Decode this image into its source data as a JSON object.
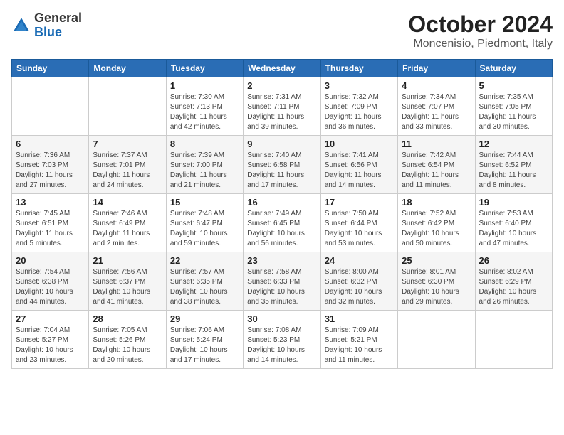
{
  "logo": {
    "general": "General",
    "blue": "Blue"
  },
  "title": {
    "month_year": "October 2024",
    "location": "Moncenisio, Piedmont, Italy"
  },
  "headers": [
    "Sunday",
    "Monday",
    "Tuesday",
    "Wednesday",
    "Thursday",
    "Friday",
    "Saturday"
  ],
  "weeks": [
    [
      {
        "day": "",
        "info": ""
      },
      {
        "day": "",
        "info": ""
      },
      {
        "day": "1",
        "info": "Sunrise: 7:30 AM\nSunset: 7:13 PM\nDaylight: 11 hours\nand 42 minutes."
      },
      {
        "day": "2",
        "info": "Sunrise: 7:31 AM\nSunset: 7:11 PM\nDaylight: 11 hours\nand 39 minutes."
      },
      {
        "day": "3",
        "info": "Sunrise: 7:32 AM\nSunset: 7:09 PM\nDaylight: 11 hours\nand 36 minutes."
      },
      {
        "day": "4",
        "info": "Sunrise: 7:34 AM\nSunset: 7:07 PM\nDaylight: 11 hours\nand 33 minutes."
      },
      {
        "day": "5",
        "info": "Sunrise: 7:35 AM\nSunset: 7:05 PM\nDaylight: 11 hours\nand 30 minutes."
      }
    ],
    [
      {
        "day": "6",
        "info": "Sunrise: 7:36 AM\nSunset: 7:03 PM\nDaylight: 11 hours\nand 27 minutes."
      },
      {
        "day": "7",
        "info": "Sunrise: 7:37 AM\nSunset: 7:01 PM\nDaylight: 11 hours\nand 24 minutes."
      },
      {
        "day": "8",
        "info": "Sunrise: 7:39 AM\nSunset: 7:00 PM\nDaylight: 11 hours\nand 21 minutes."
      },
      {
        "day": "9",
        "info": "Sunrise: 7:40 AM\nSunset: 6:58 PM\nDaylight: 11 hours\nand 17 minutes."
      },
      {
        "day": "10",
        "info": "Sunrise: 7:41 AM\nSunset: 6:56 PM\nDaylight: 11 hours\nand 14 minutes."
      },
      {
        "day": "11",
        "info": "Sunrise: 7:42 AM\nSunset: 6:54 PM\nDaylight: 11 hours\nand 11 minutes."
      },
      {
        "day": "12",
        "info": "Sunrise: 7:44 AM\nSunset: 6:52 PM\nDaylight: 11 hours\nand 8 minutes."
      }
    ],
    [
      {
        "day": "13",
        "info": "Sunrise: 7:45 AM\nSunset: 6:51 PM\nDaylight: 11 hours\nand 5 minutes."
      },
      {
        "day": "14",
        "info": "Sunrise: 7:46 AM\nSunset: 6:49 PM\nDaylight: 11 hours\nand 2 minutes."
      },
      {
        "day": "15",
        "info": "Sunrise: 7:48 AM\nSunset: 6:47 PM\nDaylight: 10 hours\nand 59 minutes."
      },
      {
        "day": "16",
        "info": "Sunrise: 7:49 AM\nSunset: 6:45 PM\nDaylight: 10 hours\nand 56 minutes."
      },
      {
        "day": "17",
        "info": "Sunrise: 7:50 AM\nSunset: 6:44 PM\nDaylight: 10 hours\nand 53 minutes."
      },
      {
        "day": "18",
        "info": "Sunrise: 7:52 AM\nSunset: 6:42 PM\nDaylight: 10 hours\nand 50 minutes."
      },
      {
        "day": "19",
        "info": "Sunrise: 7:53 AM\nSunset: 6:40 PM\nDaylight: 10 hours\nand 47 minutes."
      }
    ],
    [
      {
        "day": "20",
        "info": "Sunrise: 7:54 AM\nSunset: 6:38 PM\nDaylight: 10 hours\nand 44 minutes."
      },
      {
        "day": "21",
        "info": "Sunrise: 7:56 AM\nSunset: 6:37 PM\nDaylight: 10 hours\nand 41 minutes."
      },
      {
        "day": "22",
        "info": "Sunrise: 7:57 AM\nSunset: 6:35 PM\nDaylight: 10 hours\nand 38 minutes."
      },
      {
        "day": "23",
        "info": "Sunrise: 7:58 AM\nSunset: 6:33 PM\nDaylight: 10 hours\nand 35 minutes."
      },
      {
        "day": "24",
        "info": "Sunrise: 8:00 AM\nSunset: 6:32 PM\nDaylight: 10 hours\nand 32 minutes."
      },
      {
        "day": "25",
        "info": "Sunrise: 8:01 AM\nSunset: 6:30 PM\nDaylight: 10 hours\nand 29 minutes."
      },
      {
        "day": "26",
        "info": "Sunrise: 8:02 AM\nSunset: 6:29 PM\nDaylight: 10 hours\nand 26 minutes."
      }
    ],
    [
      {
        "day": "27",
        "info": "Sunrise: 7:04 AM\nSunset: 5:27 PM\nDaylight: 10 hours\nand 23 minutes."
      },
      {
        "day": "28",
        "info": "Sunrise: 7:05 AM\nSunset: 5:26 PM\nDaylight: 10 hours\nand 20 minutes."
      },
      {
        "day": "29",
        "info": "Sunrise: 7:06 AM\nSunset: 5:24 PM\nDaylight: 10 hours\nand 17 minutes."
      },
      {
        "day": "30",
        "info": "Sunrise: 7:08 AM\nSunset: 5:23 PM\nDaylight: 10 hours\nand 14 minutes."
      },
      {
        "day": "31",
        "info": "Sunrise: 7:09 AM\nSunset: 5:21 PM\nDaylight: 10 hours\nand 11 minutes."
      },
      {
        "day": "",
        "info": ""
      },
      {
        "day": "",
        "info": ""
      }
    ]
  ]
}
